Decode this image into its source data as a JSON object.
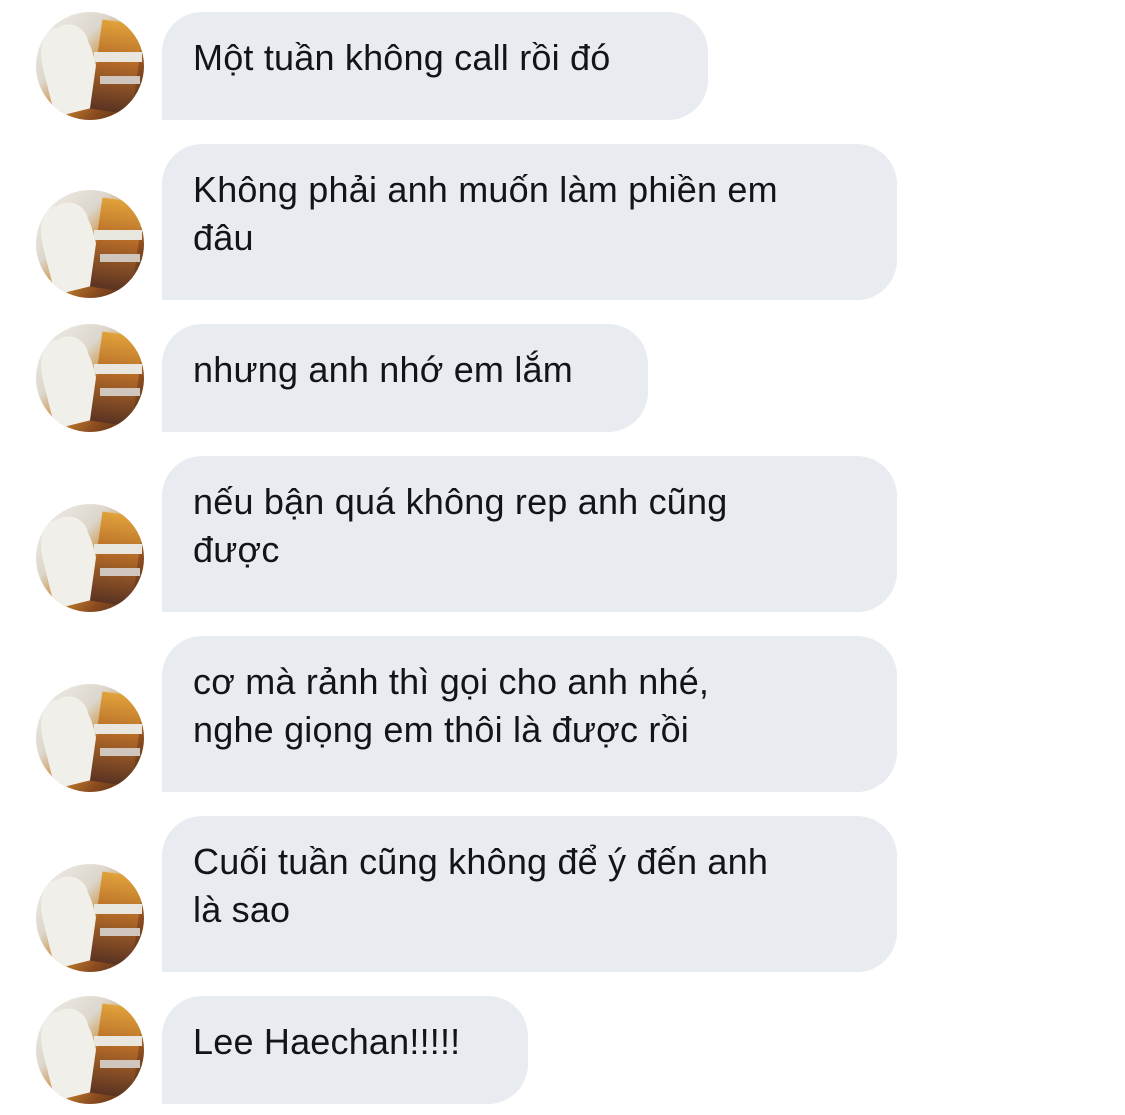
{
  "conversation": {
    "messages": [
      {
        "text": "Một tuần không call rồi đó"
      },
      {
        "text": "Không phải anh muốn làm phiền em\nđâu"
      },
      {
        "text": "nhưng anh nhớ em lắm"
      },
      {
        "text": "nếu bận quá không rep anh cũng\nđược"
      },
      {
        "text": "cơ mà rảnh thì gọi cho anh nhé,\nnghe giọng em thôi là được rồi"
      },
      {
        "text": "Cuối tuần cũng không để ý đến anh\nlà sao"
      },
      {
        "text": "Lee Haechan!!!!!"
      }
    ]
  },
  "colors": {
    "bubble_background": "#e8ebef",
    "text": "#111418",
    "page_background": "#ffffff"
  },
  "icons": {
    "avatar": "user-avatar-photo"
  }
}
